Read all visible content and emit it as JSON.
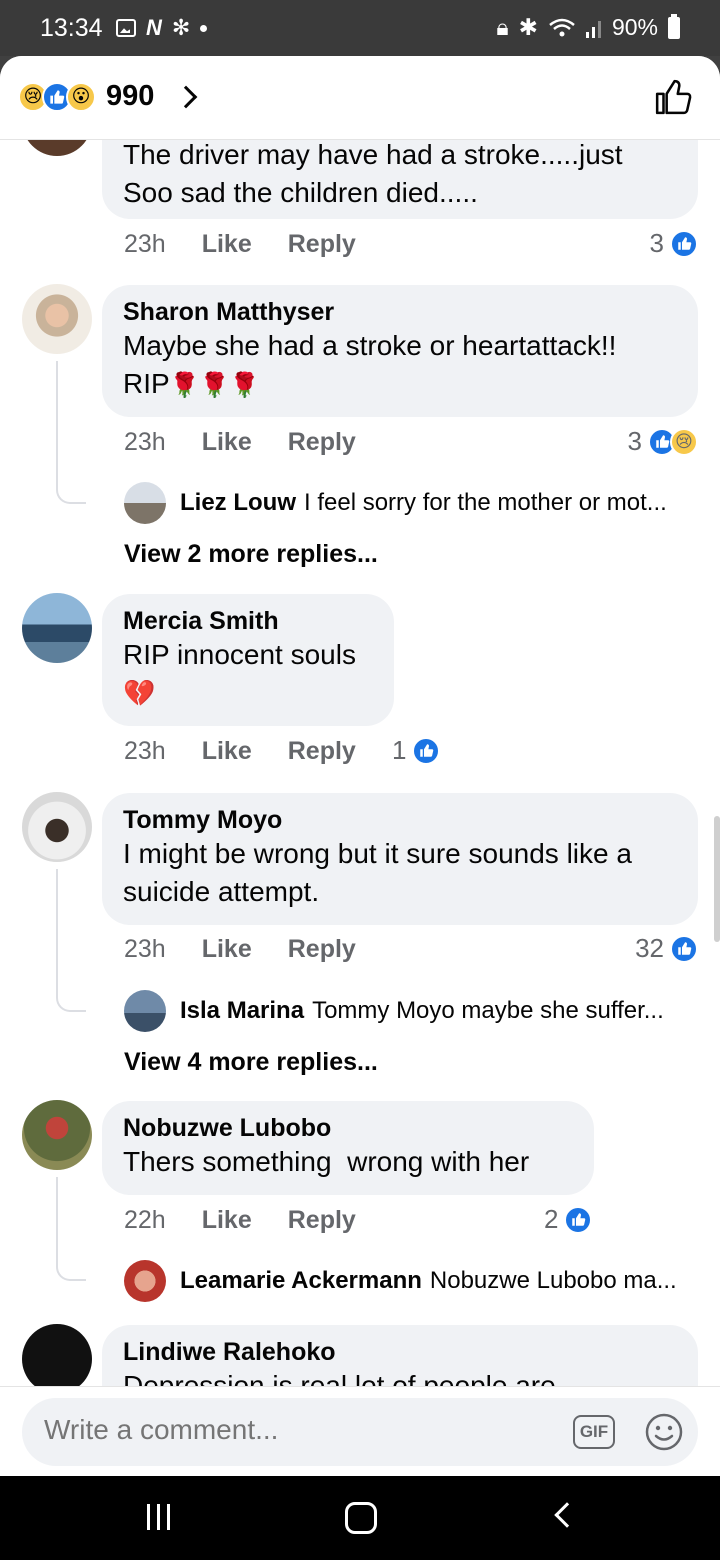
{
  "status_bar": {
    "time": "13:34",
    "battery": "90%",
    "left_icons": [
      "gallery-icon",
      "netflix-icon",
      "pinwheel-icon",
      "dot-icon"
    ],
    "right_icons": [
      "lock-icon",
      "bluetooth-icon",
      "wifi-icon",
      "signal-icon",
      "battery-icon"
    ]
  },
  "header": {
    "reaction_icons": [
      "sad-reaction-icon",
      "like-reaction-icon",
      "wow-reaction-icon"
    ],
    "reaction_count": "990"
  },
  "comments": [
    {
      "lines": [
        "The driver may have had a stroke.....just",
        "Soo sad the children died....."
      ],
      "time": "23h",
      "like_label": "Like",
      "reply_label": "Reply",
      "reactions": "3"
    },
    {
      "author": "Sharon Matthyser",
      "text_line1": "Maybe she had a stroke or heartattack!!",
      "text_line2": "RIP",
      "emoji": "🌹🌹🌹",
      "time": "23h",
      "like_label": "Like",
      "reply_label": "Reply",
      "reactions": "3",
      "reply_preview": {
        "author": "Liez Louw",
        "text": "I feel sorry for the mother or mot..."
      },
      "view_more": "View 2 more replies..."
    },
    {
      "author": "Mercia Smith",
      "text": "RIP innocent souls",
      "emoji": "💔",
      "time": "23h",
      "like_label": "Like",
      "reply_label": "Reply",
      "reactions": "1"
    },
    {
      "author": "Tommy Moyo",
      "text_line1": "I might be wrong but it sure sounds like a",
      "text_line2": "suicide attempt.",
      "time": "23h",
      "like_label": "Like",
      "reply_label": "Reply",
      "reactions": "32",
      "reply_preview": {
        "author": "Isla Marina",
        "text": "Tommy Moyo maybe she suffer..."
      },
      "view_more": "View 4 more replies..."
    },
    {
      "author": "Nobuzwe Lubobo",
      "text": "Thers something  wrong with her",
      "time": "22h",
      "like_label": "Like",
      "reply_label": "Reply",
      "reactions": "2",
      "reply_preview": {
        "author": "Leamarie Ackermann",
        "text": "Nobuzwe Lubobo ma..."
      }
    },
    {
      "author": "Lindiwe Ralehoko",
      "text": "Depression is real lot of people are"
    }
  ],
  "composer": {
    "placeholder": "Write a comment...",
    "gif_label": "GIF"
  },
  "colors": {
    "accent": "#1b74e4",
    "bubble": "#f0f2f5",
    "meta": "#65676b"
  }
}
